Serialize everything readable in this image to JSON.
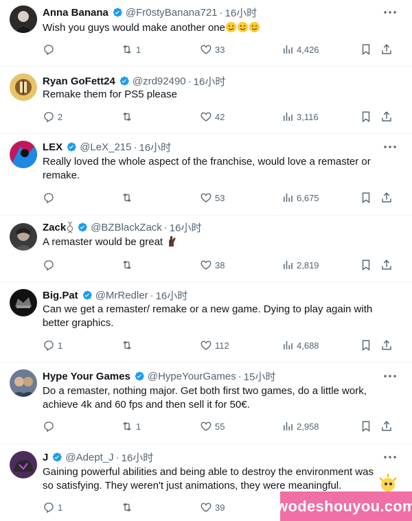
{
  "tweets": [
    {
      "name": "Anna Banana",
      "handle": "@Fr0styBanana721",
      "time": "16小时",
      "text": "Wish you guys would make another one",
      "emoji": "smiling-face-with-tear",
      "emoji_count": 3,
      "replies": "",
      "reposts": "1",
      "likes": "33",
      "views": "4,426",
      "avatar_color": "#2b2b2b"
    },
    {
      "name": "Ryan GoFett24",
      "handle": "@zrd92490",
      "time": "16小时",
      "text": "Remake them for PS5 please",
      "replies": "2",
      "reposts": "",
      "likes": "42",
      "views": "3,116",
      "avatar_color": "#e7c46a"
    },
    {
      "name": "LEX",
      "handle": "@LeX_215",
      "time": "16小时",
      "text": "Really loved the whole aspect of the franchise, would love a remaster or remake.",
      "replies": "",
      "reposts": "",
      "likes": "53",
      "views": "6,675",
      "avatar_color": "#c2185b"
    },
    {
      "name": "Zack",
      "handle": "@BZBlackZack",
      "time": "16小时",
      "text": "A remaster would be great",
      "emoji": "crossed-fingers",
      "replies": "",
      "reposts": "",
      "likes": "38",
      "views": "2,819",
      "avatar_color": "#3a3a3a"
    },
    {
      "name": "Big.Pat",
      "handle": "@MrRedler",
      "time": "16小时",
      "text": "Can we get a remaster/ remake or a new game. Dying to play again with better graphics.",
      "replies": "1",
      "reposts": "",
      "likes": "112",
      "views": "4,688",
      "avatar_color": "#111111"
    },
    {
      "name": "Hype Your Games",
      "handle": "@HypeYourGames",
      "time": "15小时",
      "text": "Do a remaster, nothing major. Get both first two games, do a little work, achieve 4k and 60 fps and then sell it for 50€.",
      "replies": "",
      "reposts": "1",
      "likes": "55",
      "views": "2,958",
      "avatar_color": "#6b7c93"
    },
    {
      "name": "J",
      "handle": "@Adept_J",
      "time": "16小时",
      "text": "Gaining powerful abilities and being able to destroy the environment was so satisfying. They weren't just animations, they were meaningful.",
      "replies": "1",
      "reposts": "",
      "likes": "39",
      "views": "",
      "avatar_color": "#4a2d5a"
    }
  ],
  "watermark": "wodeshouyou.com",
  "colors": {
    "verified": "#1d9bf0",
    "text": "#0f1419",
    "muted": "#536471",
    "divider": "#eff3f4",
    "watermark_bg": "#f06fa4"
  }
}
